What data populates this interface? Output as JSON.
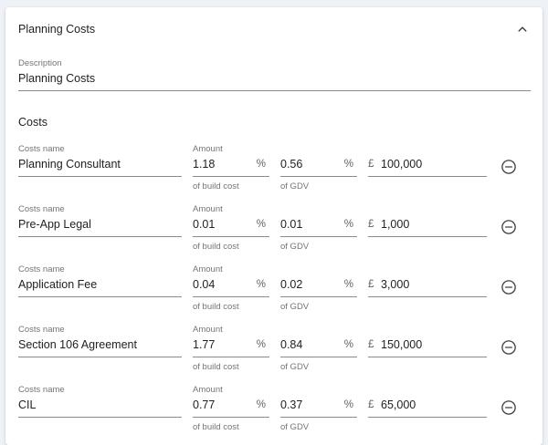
{
  "panel": {
    "title": "Planning Costs",
    "collapse_icon": "chevron-up-icon"
  },
  "description": {
    "label": "Description",
    "value": "Planning Costs"
  },
  "costs": {
    "title": "Costs",
    "rows": [
      {
        "name_label": "Costs name",
        "name": "Planning Consultant",
        "amount_label": "Amount",
        "build_pct": "1.18",
        "build_pct_suffix": "%",
        "build_helper": "of build cost",
        "gdv_pct": "0.56",
        "gdv_pct_suffix": "%",
        "gdv_helper": "of GDV",
        "currency": "£",
        "amount": "100,000",
        "remove_icon": "minus-circle-icon"
      },
      {
        "name_label": "Costs name",
        "name": "Pre-App Legal",
        "amount_label": "Amount",
        "build_pct": "0.01",
        "build_pct_suffix": "%",
        "build_helper": "of build cost",
        "gdv_pct": "0.01",
        "gdv_pct_suffix": "%",
        "gdv_helper": "of GDV",
        "currency": "£",
        "amount": "1,000",
        "remove_icon": "minus-circle-icon"
      },
      {
        "name_label": "Costs name",
        "name": "Application Fee",
        "amount_label": "Amount",
        "build_pct": "0.04",
        "build_pct_suffix": "%",
        "build_helper": "of build cost",
        "gdv_pct": "0.02",
        "gdv_pct_suffix": "%",
        "gdv_helper": "of GDV",
        "currency": "£",
        "amount": "3,000",
        "remove_icon": "minus-circle-icon"
      },
      {
        "name_label": "Costs name",
        "name": "Section 106 Agreement",
        "amount_label": "Amount",
        "build_pct": "1.77",
        "build_pct_suffix": "%",
        "build_helper": "of build cost",
        "gdv_pct": "0.84",
        "gdv_pct_suffix": "%",
        "gdv_helper": "of GDV",
        "currency": "£",
        "amount": "150,000",
        "remove_icon": "minus-circle-icon"
      },
      {
        "name_label": "Costs name",
        "name": "CIL",
        "amount_label": "Amount",
        "build_pct": "0.77",
        "build_pct_suffix": "%",
        "build_helper": "of build cost",
        "gdv_pct": "0.37",
        "gdv_pct_suffix": "%",
        "gdv_helper": "of GDV",
        "currency": "£",
        "amount": "65,000",
        "remove_icon": "minus-circle-icon"
      }
    ]
  }
}
